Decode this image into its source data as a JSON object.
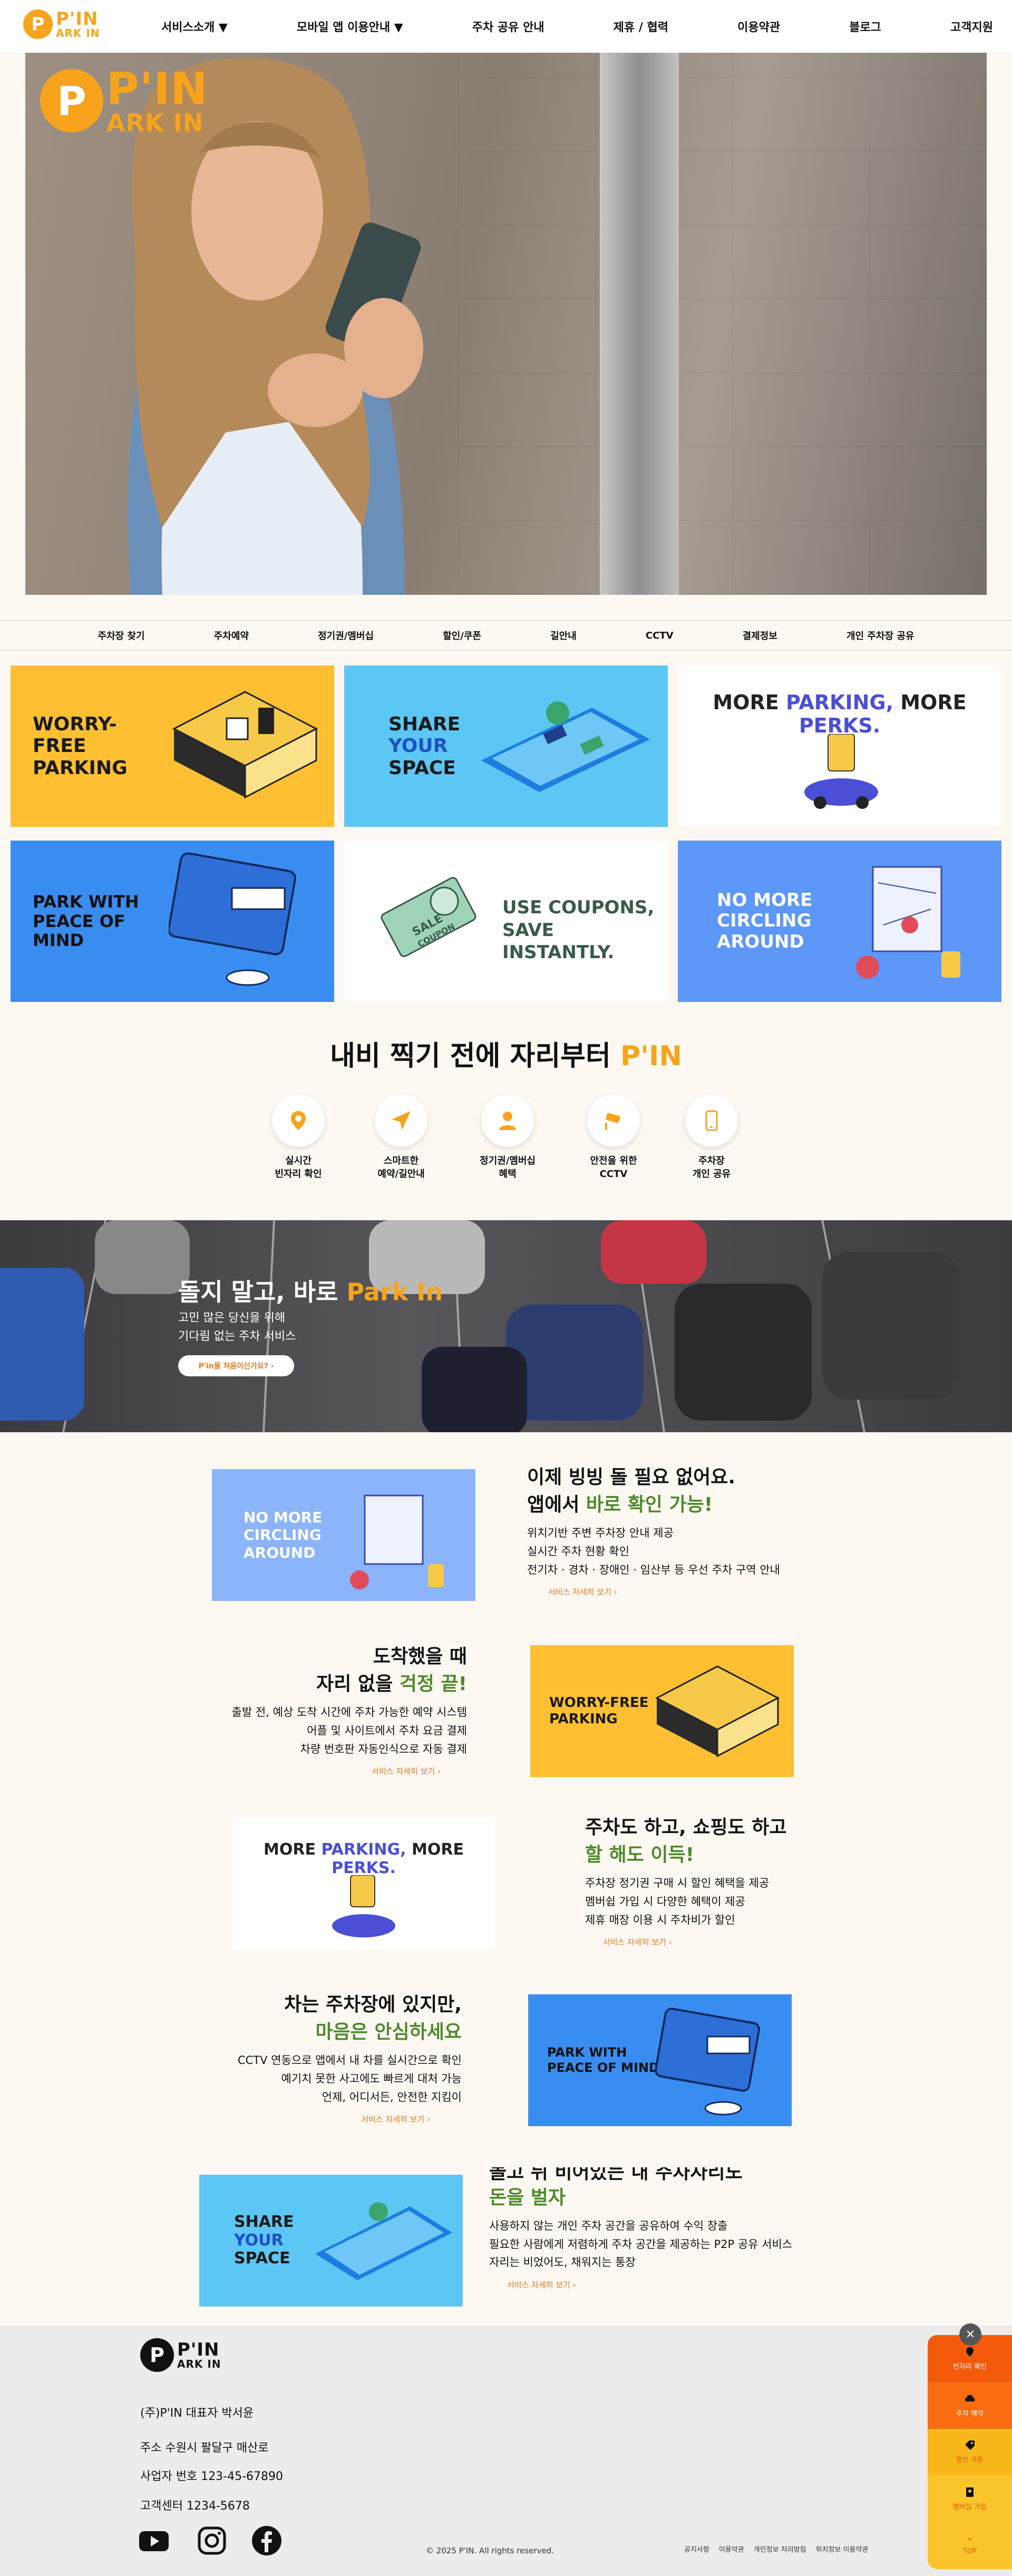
{
  "header": {
    "logo_p": "P",
    "logo_l1": "P'IN",
    "logo_l2": "ARK IN",
    "nav": [
      "서비스소개 ▼",
      "모바일 앱 이용안내 ▼",
      "주차 공유 안내",
      "제휴 / 협력",
      "이용약관",
      "블로그",
      "고객지원"
    ]
  },
  "hero": {
    "logo_p": "P",
    "logo_l1": "P'IN",
    "logo_l2": "ARK IN"
  },
  "subnav": [
    "주차장 찾기",
    "주차예약",
    "정기권/멤버십",
    "할인/쿠폰",
    "길안내",
    "CCTV",
    "결제정보",
    "개인 주차장 공유"
  ],
  "cards": {
    "worry_free": "WORRY-FREE\nPARKING",
    "share_1": "SHARE",
    "share_2": "YOUR",
    "share_3": "SPACE",
    "more_a": "MORE ",
    "more_b": "PARKING,",
    "more_c": " MORE ",
    "more_d": "PERKS.",
    "peace": "PARK WITH\nPEACE OF MIND",
    "coupon_1": "USE COUPONS,",
    "coupon_2": "SAVE INSTANTLY.",
    "coupon_sale": "SALE",
    "coupon_word": "COUPON",
    "no_more": "NO MORE\nCIRCLING\nAROUND"
  },
  "section": {
    "title_a": "내비 찍기 전에 자리부터 ",
    "title_b": "P'IN",
    "features": [
      "실시간\n빈자리 확인",
      "스마트한\n예약/길안내",
      "정기권/멤버십\n혜택",
      "안전을 위한\nCCTV",
      "주차장\n개인 공유"
    ]
  },
  "banner": {
    "title_a": "돌지 말고, 바로 ",
    "title_b": "Park In",
    "sub": "고민 많은 당신을 위해\n기다림 없는 주차 서비스",
    "button": "P'in을 처음이신가요?  ›"
  },
  "info": [
    {
      "title_a": "이제 빙빙 돌 필요 없어요.",
      "title_b": "앱에서 ",
      "title_c": "바로 확인 가능!",
      "body": "위치기반 주변 주차장 안내 제공\n실시간 주차 현황 확인\n전기차 · 경차 · 장애인 · 임산부 등 우선 주차 구역 안내",
      "link": "서비스 자세히 보기  ›"
    },
    {
      "title_a": "도착했을 때",
      "title_b": "자리 없을 ",
      "title_c": "걱정 끝!",
      "body": "출발 전, 예상 도착 시간에 주차 가능한 예약 시스템\n어플 및 사이트에서 주차 요금 결제\n차량 번호판 자동인식으로 자동 결제",
      "link": "서비스 자세히 보기  ›"
    },
    {
      "title_a": "주차도 하고, 쇼핑도 하고",
      "title_b": "",
      "title_c": "할 해도 이득!",
      "body": "주차장 정기권 구매 시 할인 혜택을 제공\n멤버쉽 가입 시 다양한 혜택이 제공\n제휴 매장 이용 시 주차비가 할인",
      "link": "서비스 자세히 보기  ›"
    },
    {
      "title_a": "차는 주차장에 있지만,",
      "title_b": "",
      "title_c": "마음은 안심하세요",
      "body": "CCTV 연동으로 앱에서 내 차를 실시간으로 확인\n예기치 못한 사고에도 빠르게 대처 가능\n언제, 어디서든, 안전한 지킴이",
      "link": "서비스 자세히 보기  ›"
    },
    {
      "title_a": "놀고 뒤 비어있는 내 주차자리도",
      "title_b": "",
      "title_c": "돈을 벌자",
      "body": "사용하지 않는 개인 주차 공간을 공유하여 수익 창출\n필요한 사람에게 저렴하게 주차 공간을 제공하는 P2P 공유 서비스\n자리는 비었어도, 채워지는 통장",
      "link": "서비스 자세히 보기  ›"
    }
  ],
  "footer": {
    "logo_p": "P",
    "logo_l1": "P'IN",
    "logo_l2": "ARK IN",
    "company": "(주)P'IN 대표자 박서윤",
    "address": "주소 수원시 팔달구 매산로",
    "biz": "사업자 번호 123-45-67890",
    "cs": "고객센터 1234-5678",
    "copyright": "© 2025 P'IN. All rights reserved.",
    "links": [
      "공지사항",
      "이용약관",
      "개인정보 처리방침",
      "위치정보 이용약관"
    ]
  },
  "float_menu": {
    "close": "✕",
    "items": [
      "빈자리 확인",
      "주차 예약",
      "할인 쿠폰",
      "멤버십 가입",
      "TOP"
    ],
    "colors": [
      "#f55a0a",
      "#f96c12",
      "#f8b81c",
      "#f9c52b",
      "#f9c52b"
    ]
  },
  "colors": {
    "brand_orange": "#f7a41c",
    "accent_green": "#4d8a2a"
  }
}
